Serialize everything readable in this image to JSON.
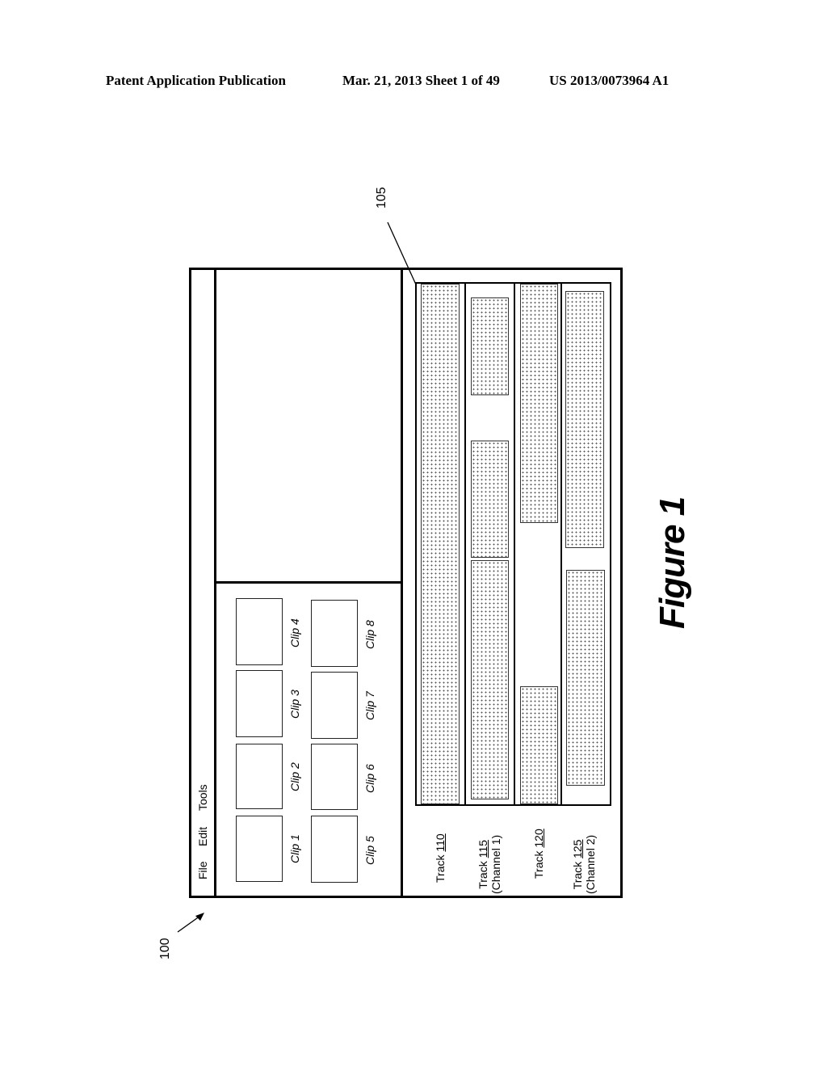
{
  "header": {
    "left": "Patent Application Publication",
    "center": "Mar. 21, 2013  Sheet 1 of 49",
    "right": "US 2013/0073964 A1"
  },
  "figure": {
    "caption": "Figure 1",
    "ref_ui": "100",
    "ref_timeline": "105"
  },
  "menubar": {
    "items": [
      "File",
      "Edit",
      "Tools"
    ]
  },
  "clip_browser": {
    "clips": [
      "Clip 1",
      "Clip 2",
      "Clip 3",
      "Clip 4",
      "Clip 5",
      "Clip 6",
      "Clip 7",
      "Clip 8"
    ]
  },
  "timeline": {
    "tracks": [
      {
        "prefix": "Track ",
        "number": "110",
        "channel": ""
      },
      {
        "prefix": "Track ",
        "number": "115",
        "channel": "(Channel 1)"
      },
      {
        "prefix": "Track ",
        "number": "120",
        "channel": ""
      },
      {
        "prefix": "Track ",
        "number": "125",
        "channel": "(Channel 2)"
      }
    ]
  }
}
